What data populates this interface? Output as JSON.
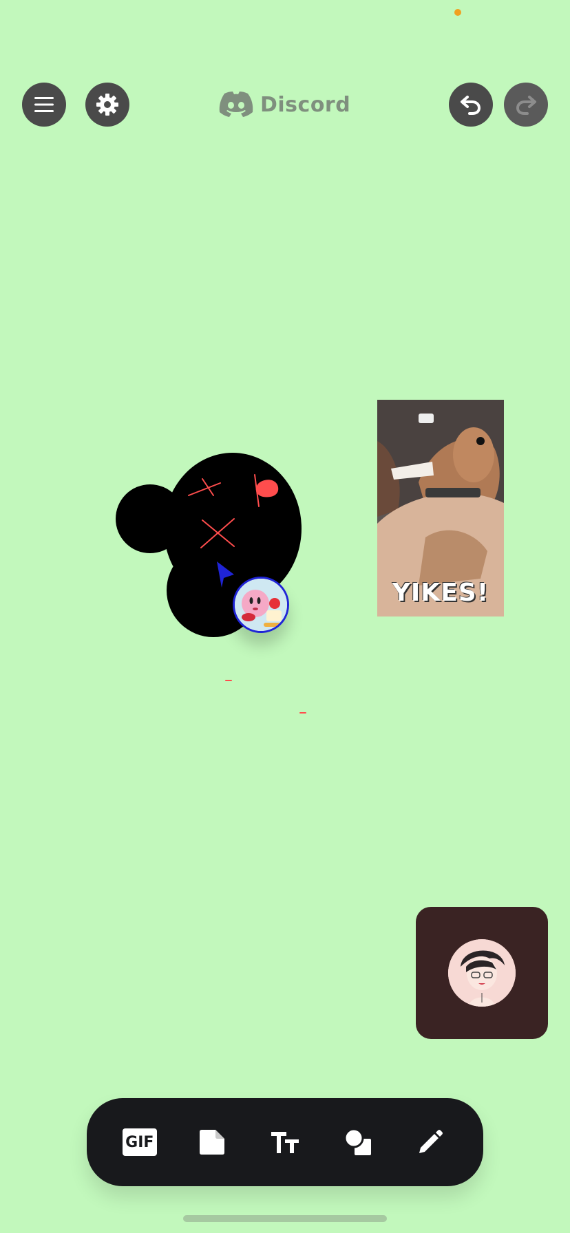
{
  "app": {
    "brand_name": "Discord"
  },
  "header": {
    "menu_icon": "hamburger-menu-icon",
    "settings_icon": "gear-icon",
    "brand_icon": "discord-logo-icon",
    "undo_icon": "undo-icon",
    "redo_icon": "redo-icon"
  },
  "canvas": {
    "gif_card": {
      "caption": "YIKES!"
    }
  },
  "toolbar": {
    "gif_label": "GIF",
    "tools": [
      "gif-icon",
      "sticky-note-icon",
      "text-icon",
      "shapes-icon",
      "pencil-icon"
    ]
  },
  "colors": {
    "background": "#c2f8bc",
    "toolbar": "#18191c",
    "call_tile": "#3a2323",
    "cursor": "#1f24d6",
    "ink": "#ff4d4d"
  }
}
